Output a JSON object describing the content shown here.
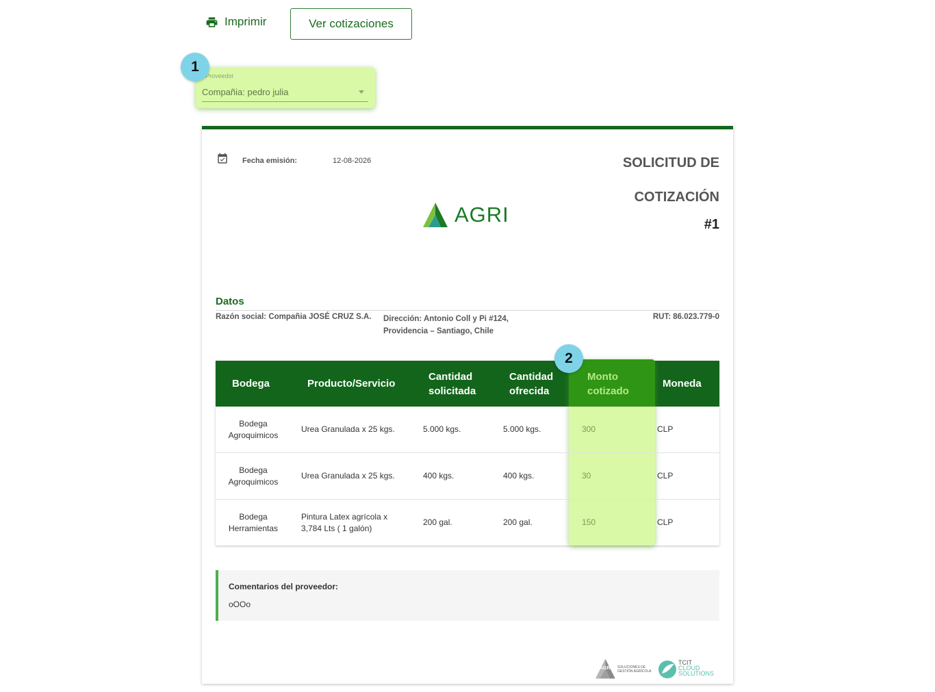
{
  "toolbar": {
    "print_label": "Imprimir",
    "quotes_label": "Ver cotizaciones"
  },
  "provider": {
    "label": "Proveedor",
    "value": "Compañia: pedro julia"
  },
  "markers": [
    "1",
    "2"
  ],
  "document": {
    "fecha_label": "Fecha emisión:",
    "fecha_value": "12-08-2026",
    "title_line1": "SOLICITUD DE",
    "title_line2": "COTIZACIÓN",
    "title_number": "#1",
    "logo_text": "AGRI",
    "datos": {
      "title": "Datos",
      "razon_social": "Razón social: Compañia JOSÉ CRUZ S.A.",
      "direccion_line1": "Dirección: Antonio Coll y Pi #124,",
      "direccion_line2": "Providencia – Santiago, Chile",
      "rut": "RUT: 86.023.779-0"
    },
    "table": {
      "headers": {
        "bodega": "Bodega",
        "producto": "Producto/Servicio",
        "cant_sol_1": "Cantidad",
        "cant_sol_2": "solicitada",
        "cant_of_1": "Cantidad",
        "cant_of_2": "ofrecida",
        "monto_1": "Monto",
        "monto_2": "cotizado",
        "moneda": "Moneda"
      },
      "rows": [
        {
          "bodega_1": "Bodega",
          "bodega_2": "Agroquimicos",
          "producto_1": "Urea Granulada x 25 kgs.",
          "producto_2": "",
          "solicitada": "5.000 kgs.",
          "ofrecida": "5.000 kgs.",
          "monto": "300",
          "moneda": "CLP"
        },
        {
          "bodega_1": "Bodega",
          "bodega_2": "Agroquimicos",
          "producto_1": "Urea Granulada x 25 kgs.",
          "producto_2": "",
          "solicitada": "400 kgs.",
          "ofrecida": "400 kgs.",
          "monto": "30",
          "moneda": "CLP"
        },
        {
          "bodega_1": "Bodega",
          "bodega_2": "Herramientas",
          "producto_1": "Pintura Latex agrícola x",
          "producto_2": "3,784 Lts ( 1 galón)",
          "solicitada": "200 gal.",
          "ofrecida": "200 gal.",
          "monto": "150",
          "moneda": "CLP"
        }
      ]
    },
    "comments": {
      "title": "Comentarios del proveedor:",
      "text": "oOOo"
    },
    "footer": {
      "agri_badge": "AGRI",
      "agri_sub_1": "SOLUCIONES DE",
      "agri_sub_2": "GESTIÓN AGRÍCOLA",
      "tcit_1": "TCIT",
      "tcit_2": "CLOUD",
      "tcit_3": "SOLUTIONS"
    }
  },
  "colors": {
    "primary_green": "#13651b",
    "highlight": "#d9f9a6",
    "marker": "#7fd3e8"
  }
}
